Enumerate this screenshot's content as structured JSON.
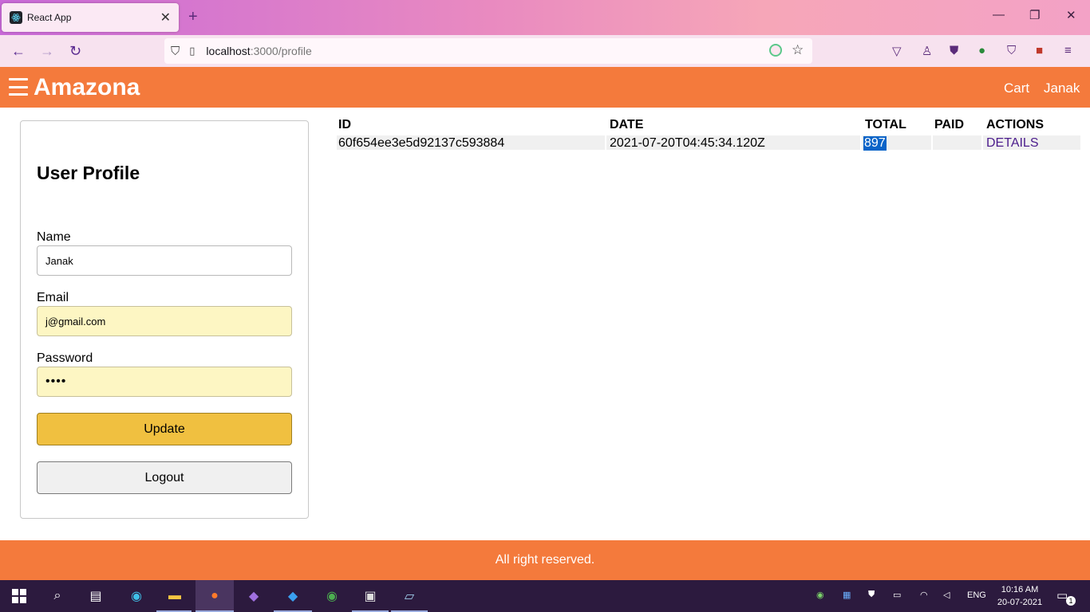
{
  "browser": {
    "tab_title": "React App",
    "url_host": "localhost",
    "url_path": ":3000/profile"
  },
  "header": {
    "brand": "Amazona",
    "cart_link": "Cart",
    "user_link": "Janak"
  },
  "profile": {
    "title": "User Profile",
    "name_label": "Name",
    "name_value": "Janak",
    "email_label": "Email",
    "email_value": "j@gmail.com",
    "password_label": "Password",
    "password_value": "••••",
    "update_button": "Update",
    "logout_button": "Logout"
  },
  "orders": {
    "columns": [
      "ID",
      "DATE",
      "TOTAL",
      "PAID",
      "ACTIONS"
    ],
    "rows": [
      {
        "id": "60f654ee3e5d92137c593884",
        "date": "2021-07-20T04:45:34.120Z",
        "total": "897",
        "paid": "",
        "action": "DETAILS"
      }
    ]
  },
  "footer": {
    "text": "All right reserved."
  },
  "taskbar": {
    "lang": "ENG",
    "time": "10:16 AM",
    "date": "20-07-2021",
    "notification_count": "1"
  },
  "colors": {
    "brand_orange": "#f47a3c",
    "update_button": "#f0c040",
    "autofill": "#fdf6c3"
  }
}
